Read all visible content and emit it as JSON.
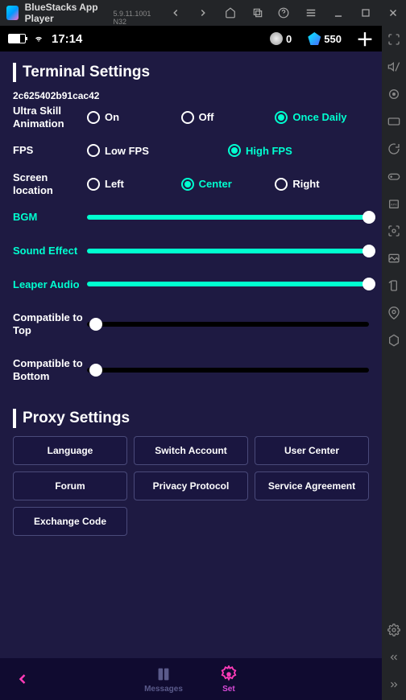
{
  "titlebar": {
    "app_name": "BlueStacks App Player",
    "version": "5.9.11.1001 N32"
  },
  "status": {
    "time": "17:14",
    "coins": "0",
    "gems": "550"
  },
  "sections": {
    "terminal": "Terminal Settings",
    "proxy": "Proxy Settings"
  },
  "hexcode": "2c625402b91cac42",
  "settings": {
    "ultraSkill": {
      "label": "Ultra Skill Animation",
      "options": [
        "On",
        "Off",
        "Once Daily"
      ],
      "selected": 2
    },
    "fps": {
      "label": "FPS",
      "options": [
        "Low FPS",
        "High FPS"
      ],
      "selected": 1
    },
    "screenLoc": {
      "label": "Screen location",
      "options": [
        "Left",
        "Center",
        "Right"
      ],
      "selected": 1
    }
  },
  "sliders": {
    "bgm": {
      "label": "BGM",
      "value": 100,
      "accent": true
    },
    "soundEffect": {
      "label": "Sound Effect",
      "value": 100,
      "accent": true
    },
    "leaperAudio": {
      "label": "Leaper Audio",
      "value": 100,
      "accent": true
    },
    "compatTop": {
      "label": "Compatible to Top",
      "value": 3,
      "accent": false
    },
    "compatBottom": {
      "label": "Compatible to Bottom",
      "value": 3,
      "accent": false
    }
  },
  "proxyButtons": [
    "Language",
    "Switch Account",
    "User Center",
    "Forum",
    "Privacy Protocol",
    "Service Agreement",
    "Exchange Code"
  ],
  "bottomnav": {
    "messages": "Messages",
    "set": "Set"
  }
}
